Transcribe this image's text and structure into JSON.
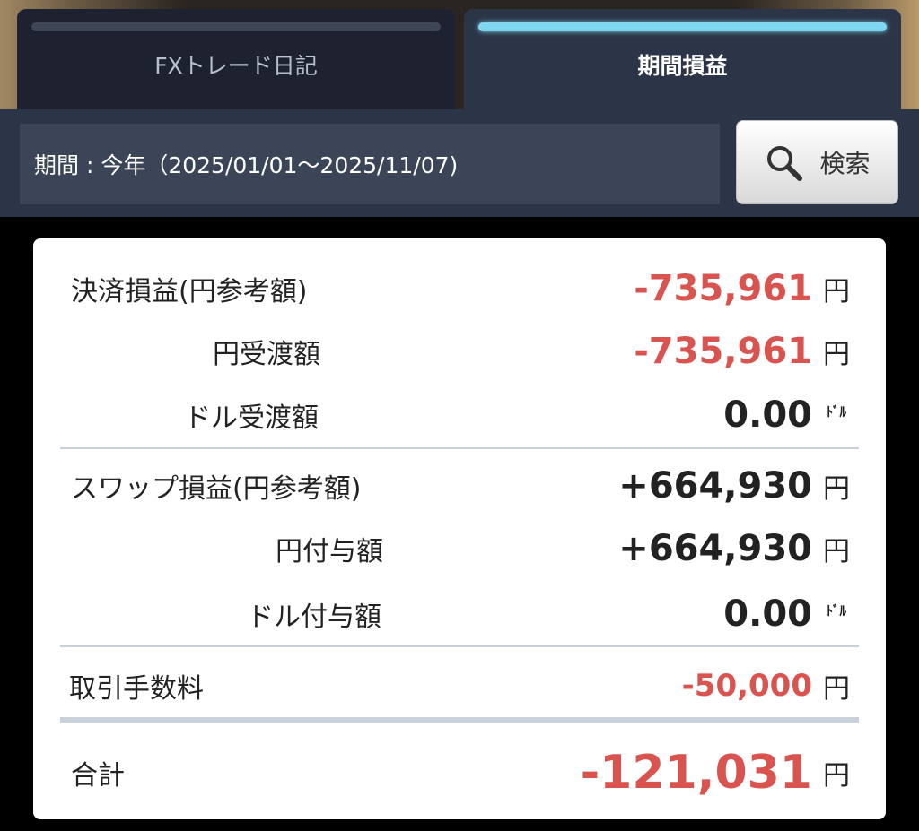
{
  "tabs": [
    {
      "label": "FXトレード日記",
      "active": false
    },
    {
      "label": "期間損益",
      "active": true
    }
  ],
  "period": {
    "text": "期間 : 今年（2025/01/01～2025/11/07)"
  },
  "search_button": {
    "label": "検索",
    "icon": "search-icon"
  },
  "rows": {
    "settlement": {
      "label": "決済損益(円参考額)",
      "value": "-735,961",
      "unit": "円"
    },
    "yen_delivery": {
      "label": "円受渡額",
      "value": "-735,961",
      "unit": "円"
    },
    "dollar_delivery": {
      "label": "ドル受渡額",
      "value": "0.00",
      "unit": "ﾄﾞﾙ"
    },
    "swap": {
      "label": "スワップ損益(円参考額)",
      "value": "+664,930",
      "unit": "円"
    },
    "yen_grant": {
      "label": "円付与額",
      "value": "+664,930",
      "unit": "円"
    },
    "dollar_grant": {
      "label": "ドル付与額",
      "value": "0.00",
      "unit": "ﾄﾞﾙ"
    },
    "fee": {
      "label": "取引手数料",
      "value": "-50,000",
      "unit": "円"
    },
    "total": {
      "label": "合計",
      "value": "-121,031",
      "unit": "円"
    }
  },
  "colors": {
    "negative": "#d9534f",
    "positive": "#222222",
    "accent": "#7fd8f0"
  }
}
